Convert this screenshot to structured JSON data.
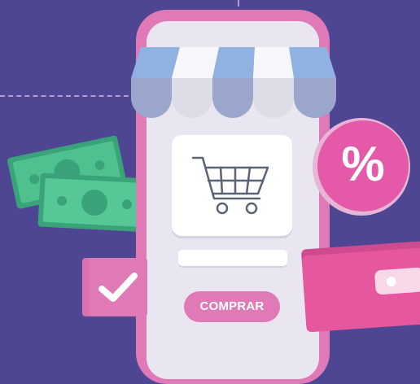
{
  "colors": {
    "background": "#4e4593",
    "phone_frame": "#e07ab7",
    "phone_screen": "#e9e6f1",
    "awning_blue": "#8fb2e3",
    "awning_white": "#f7f7fb",
    "cash_green": "#4fc18f",
    "badge_pink": "#e45aa8",
    "wallet_pink": "#e5589e"
  },
  "icons": {
    "cart": "shopping-cart-icon",
    "check": "checkmark-icon",
    "percent": "percent-icon",
    "cash": "banknote-icon",
    "wallet": "wallet-icon"
  },
  "buy_button": {
    "label": "COMPRAR"
  },
  "discount_badge": {
    "symbol": "%"
  }
}
